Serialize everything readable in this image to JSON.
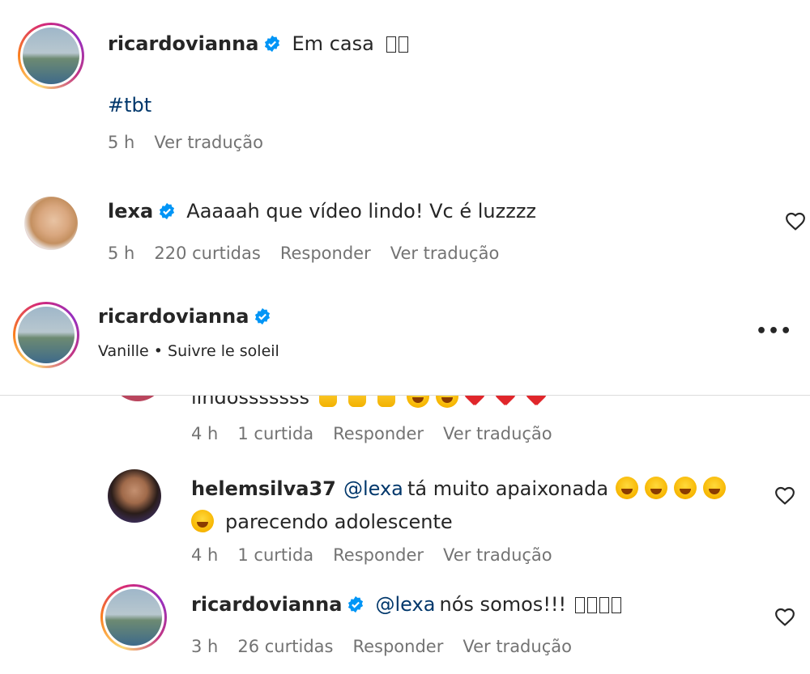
{
  "post": {
    "username": "ricardovianna",
    "caption": "Em casa",
    "hashtag": "#tbt",
    "time": "5 h",
    "translate": "Ver tradução"
  },
  "comments": [
    {
      "username": "lexa",
      "text": "Aaaaah que vídeo lindo! Vc é luzzzz",
      "time": "5 h",
      "likes": "220 curtidas",
      "reply": "Responder",
      "translate": "Ver tradução"
    }
  ],
  "header": {
    "username": "ricardovianna",
    "audio": "Vanille • Suivre le soleil",
    "more": "•••"
  },
  "replies": [
    {
      "partial_text": "lindosssssss",
      "time": "4 h",
      "likes": "1 curtida",
      "reply": "Responder",
      "translate": "Ver tradução"
    },
    {
      "username": "helemsilva37",
      "mention": "@lexa",
      "text_line1": "tá muito apaixonada",
      "text_line2": "parecendo adolescente",
      "time": "4 h",
      "likes": "1 curtida",
      "reply": "Responder",
      "translate": "Ver tradução"
    },
    {
      "username": "ricardovianna",
      "mention": "@lexa",
      "text": "nós somos!!!",
      "time": "3 h",
      "likes": "26 curtidas",
      "reply": "Responder",
      "translate": "Ver tradução"
    }
  ],
  "icons": {
    "verified_color": "#0095f6",
    "heart": "heart-outline-icon"
  }
}
